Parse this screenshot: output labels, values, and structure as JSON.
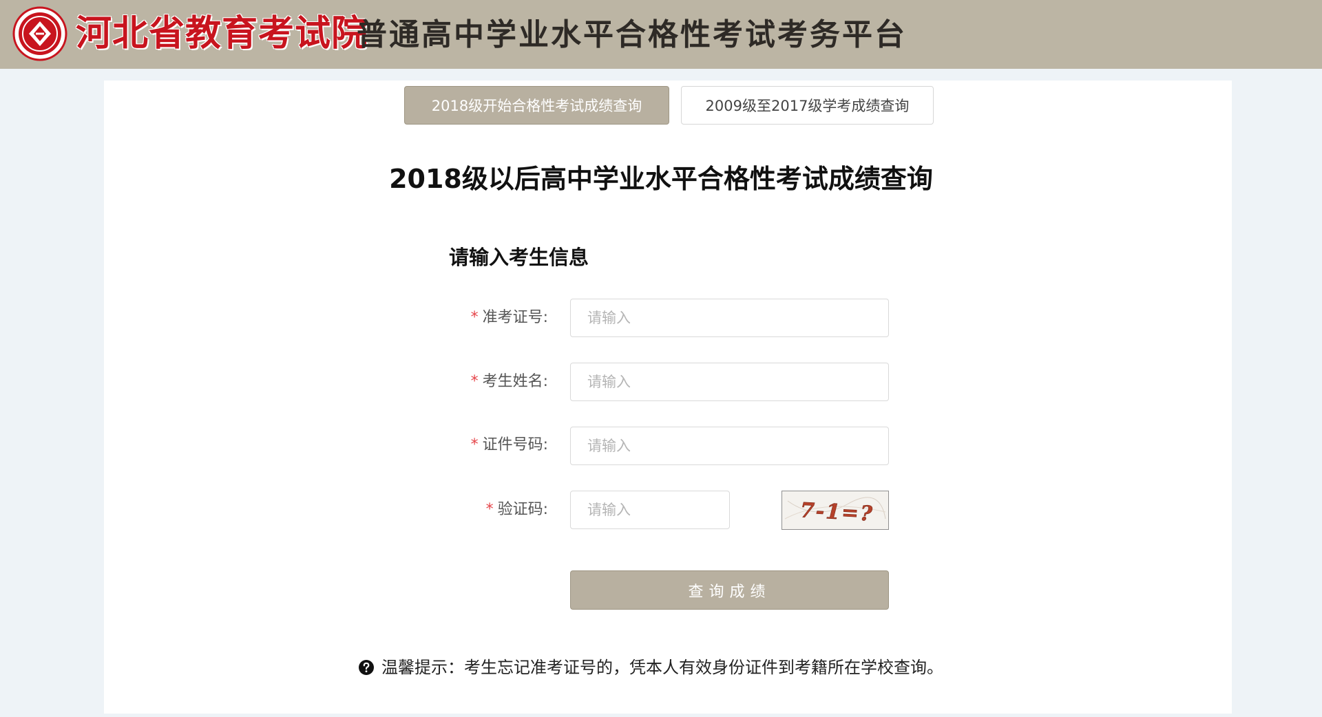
{
  "header": {
    "org_name": "河北省教育考试院",
    "platform_name": "普通高中学业水平合格性考试考务平台",
    "colors": {
      "bar": "#bcb5a4",
      "brand_red": "#c8141e"
    },
    "logo_icon": "emblem-logo-icon"
  },
  "tabs": [
    {
      "label": "2018级开始合格性考试成绩查询",
      "active": true
    },
    {
      "label": "2009级至2017级学考成绩查询",
      "active": false
    }
  ],
  "page_title": "2018级以后高中学业水平合格性考试成绩查询",
  "form": {
    "section_title": "请输入考生信息",
    "required_mark": "*",
    "fields": [
      {
        "label": "准考证号:",
        "placeholder": "请输入",
        "value": ""
      },
      {
        "label": "考生姓名:",
        "placeholder": "请输入",
        "value": ""
      },
      {
        "label": "证件号码:",
        "placeholder": "请输入",
        "value": ""
      },
      {
        "label": "验证码:",
        "placeholder": "请输入",
        "value": ""
      }
    ],
    "captcha_text": "7-1=?",
    "submit_label": "查询成绩"
  },
  "tip": {
    "icon": "question-circle-icon",
    "text": "温馨提示：考生忘记准考证号的，凭本人有效身份证件到考籍所在学校查询。"
  },
  "colors": {
    "accent": "#b8b0a0",
    "required": "#e5454a",
    "background": "#eef3f7",
    "card": "#ffffff"
  }
}
